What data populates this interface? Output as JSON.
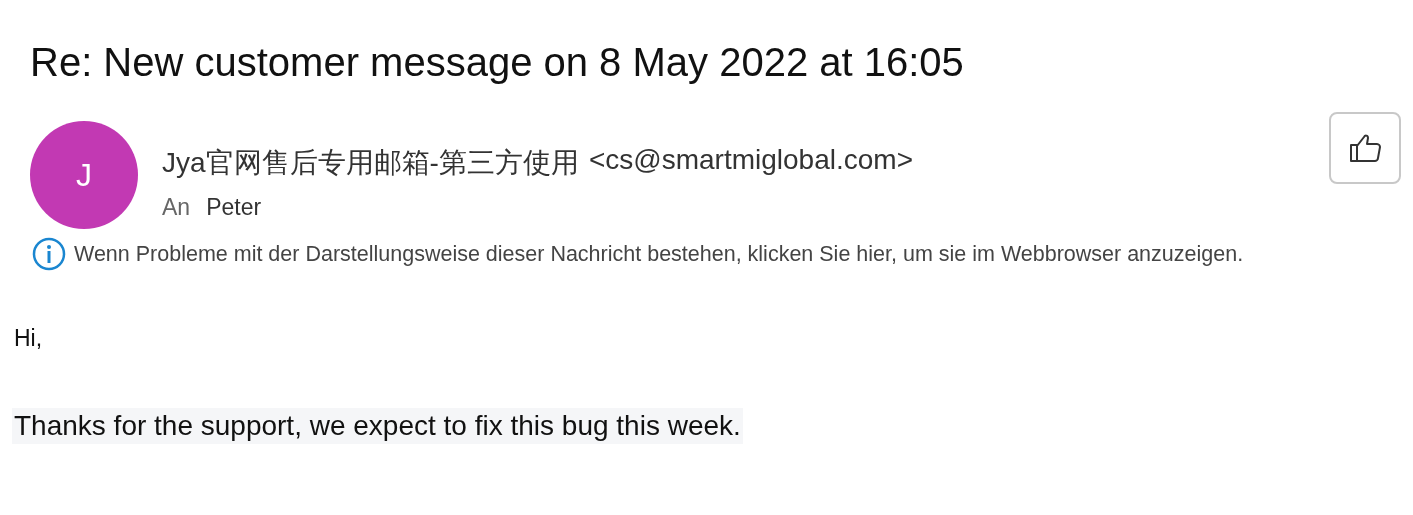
{
  "subject": "Re: New customer message on 8 May 2022 at 16:05",
  "sender": {
    "avatar_letter": "J",
    "name": "Jya官网售后专用邮箱-第三方使用",
    "email": "<cs@smartmiglobal.com>"
  },
  "recipients": {
    "label": "An",
    "names": [
      "Peter"
    ]
  },
  "info_bar": {
    "text": "Wenn Probleme mit der Darstellungsweise dieser Nachricht bestehen, klicken Sie hier, um sie im Webbrowser anzuzeigen."
  },
  "body": [
    {
      "text": "Hi,",
      "highlighted": false
    },
    {
      "text": "Thanks for the support, we expect to fix this bug this week.",
      "highlighted": true
    }
  ]
}
